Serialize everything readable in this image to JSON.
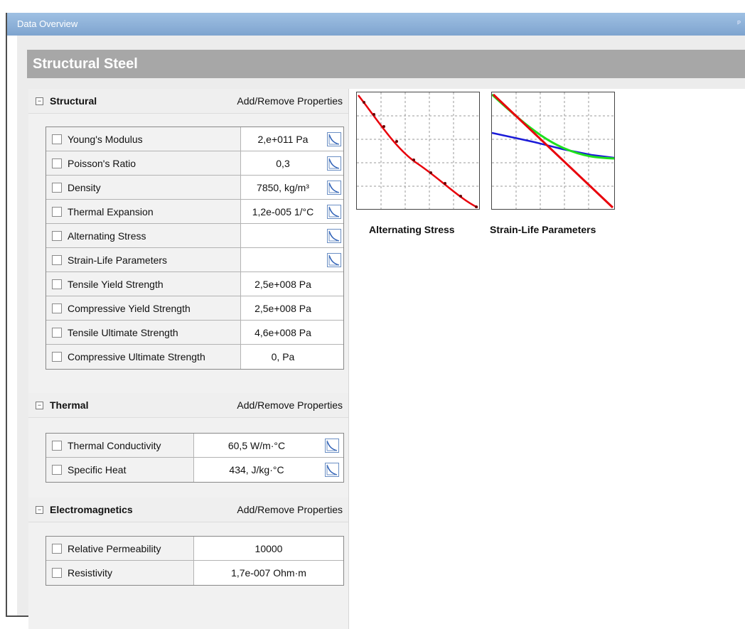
{
  "window": {
    "title": "Data Overview"
  },
  "material": {
    "name": "Structural Steel"
  },
  "sections": {
    "structural": {
      "title": "Structural",
      "action": "Add/Remove Properties",
      "rows": [
        {
          "label": "Young's Modulus",
          "value": "2,e+011  Pa",
          "has_chart": true
        },
        {
          "label": "Poisson's Ratio",
          "value": "0,3",
          "has_chart": true
        },
        {
          "label": "Density",
          "value": "7850,  kg/m³",
          "has_chart": true
        },
        {
          "label": "Thermal Expansion",
          "value": "1,2e-005  1/°C",
          "has_chart": true
        },
        {
          "label": "Alternating Stress",
          "value": "",
          "has_chart": true
        },
        {
          "label": "Strain-Life Parameters",
          "value": "",
          "has_chart": true
        },
        {
          "label": "Tensile Yield Strength",
          "value": "2,5e+008  Pa",
          "has_chart": false
        },
        {
          "label": "Compressive Yield Strength",
          "value": "2,5e+008  Pa",
          "has_chart": false
        },
        {
          "label": "Tensile Ultimate Strength",
          "value": "4,6e+008  Pa",
          "has_chart": false
        },
        {
          "label": "Compressive Ultimate Strength",
          "value": "0,  Pa",
          "has_chart": false
        }
      ]
    },
    "thermal": {
      "title": "Thermal",
      "action": "Add/Remove Properties",
      "rows": [
        {
          "label": "Thermal Conductivity",
          "value": "60,5  W/m·°C",
          "has_chart": true
        },
        {
          "label": "Specific Heat",
          "value": "434,  J/kg·°C",
          "has_chart": true
        }
      ]
    },
    "electromagnetics": {
      "title": "Electromagnetics",
      "action": "Add/Remove Properties",
      "rows": [
        {
          "label": "Relative Permeability",
          "value": "10000",
          "has_chart": false
        },
        {
          "label": "Resistivity",
          "value": "1,7e-007  Ohm·m",
          "has_chart": false
        }
      ]
    }
  },
  "previews": {
    "alternating": {
      "label": "Alternating Stress"
    },
    "strain_life": {
      "label": "Strain-Life Parameters"
    }
  },
  "colors": {
    "banner": "#a7a7a7",
    "titlebar": "#7ea4cf",
    "curve_red": "#e8000b",
    "curve_blue": "#1a1ad8",
    "curve_green": "#1ee01e"
  },
  "icons": {
    "collapse": "minus-box",
    "property_chart": "curve-icon",
    "checkbox": "checkbox"
  }
}
